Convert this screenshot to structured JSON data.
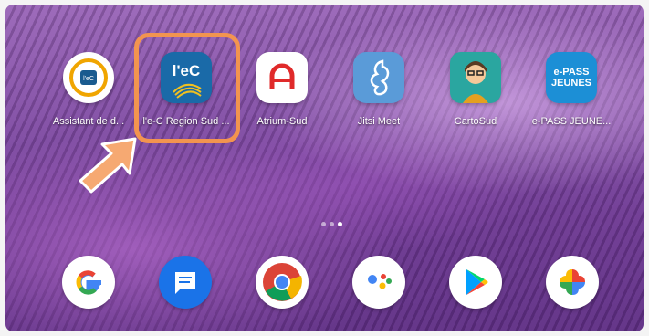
{
  "home_screen": {
    "apps": [
      {
        "label": "Assistant de d..."
      },
      {
        "label": "l'e-C Region Sud ..."
      },
      {
        "label": "Atrium-Sud"
      },
      {
        "label": "Jitsi Meet"
      },
      {
        "label": "CartoSud"
      },
      {
        "label": "e-PASS JEUNE..."
      }
    ],
    "icon_text": {
      "assistant": "l'eC",
      "ec_region": "l'eC",
      "epass_line1": "e-PASS",
      "epass_line2": "JEUNES"
    },
    "page_indicator": {
      "count": 3,
      "active_index": 2
    }
  },
  "dock": {
    "apps": [
      "google-icon",
      "messages-icon",
      "chrome-icon",
      "assistant-icon",
      "play-store-icon",
      "photos-icon"
    ]
  },
  "annotation": {
    "highlight_color": "#f2944f",
    "arrow_color": "#f6a972"
  }
}
